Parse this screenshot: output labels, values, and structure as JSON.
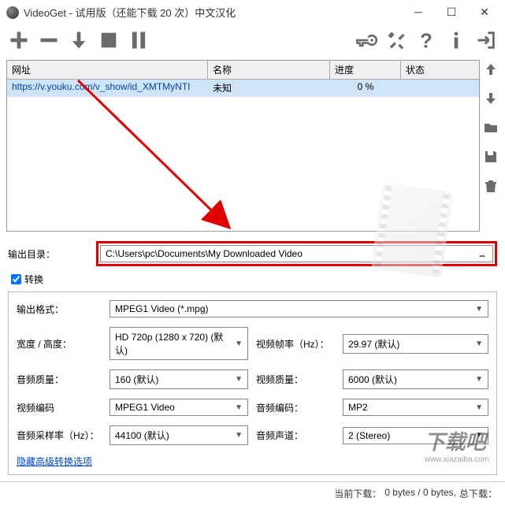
{
  "window": {
    "title": "VideoGet - 试用版（还能下载 20 次）中文汉化"
  },
  "table": {
    "headers": {
      "url": "网址",
      "name": "名称",
      "progress": "进度",
      "status": "状态"
    },
    "row": {
      "url": "https://v.youku.com/v_show/id_XMTMyNTI",
      "name": "未知",
      "progress": "0 %",
      "status": ""
    }
  },
  "outdir": {
    "label": "输出目录：",
    "value": "C:\\Users\\pc\\Documents\\My Downloaded Video",
    "browse": "..."
  },
  "convert": {
    "label": "转换"
  },
  "settings": {
    "outputFormat": {
      "label": "输出格式：",
      "value": "MPEG1 Video (*.mpg)"
    },
    "widthHeight": {
      "label": "宽度 / 高度：",
      "value": "HD 720p (1280 x 720) (默认)"
    },
    "videoFps": {
      "label": "视频帧率（Hz）：",
      "value": "29.97 (默认)"
    },
    "audioQuality": {
      "label": "音频质量：",
      "value": "160 (默认)"
    },
    "videoQuality": {
      "label": "视频质量：",
      "value": "6000 (默认)"
    },
    "videoCodec": {
      "label": "视频编码",
      "value": "MPEG1 Video"
    },
    "audioCodec": {
      "label": "音频编码：",
      "value": "MP2"
    },
    "audioSample": {
      "label": "音频采样率（Hz）：",
      "value": "44100 (默认)"
    },
    "audioChannel": {
      "label": "音频声道：",
      "value": "2 (Stereo)"
    },
    "hideAdvanced": "隐藏高级转换选项"
  },
  "statusbar": {
    "current": "当前下载：",
    "currentVal": "0 bytes / 0 bytes,",
    "total": "总下载："
  },
  "watermark": {
    "site": "www.xiazaiba.com",
    "name": "下载吧"
  }
}
